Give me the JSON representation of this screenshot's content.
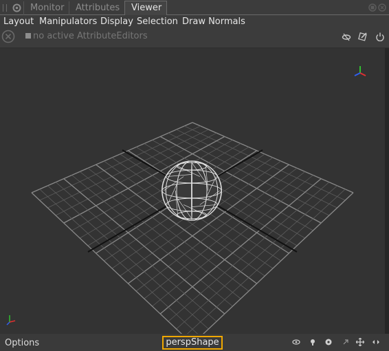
{
  "tabs": [
    {
      "label": "Monitor",
      "active": false
    },
    {
      "label": "Attributes",
      "active": false
    },
    {
      "label": "Viewer",
      "active": true
    }
  ],
  "menu": [
    "Layout",
    "Manipulators",
    "Display",
    "Selection",
    "Draw Normals"
  ],
  "info": {
    "text": "no active AttributeEditors"
  },
  "viewport": {
    "background": "#333333",
    "axis_colors": {
      "x": "#e03030",
      "y": "#30c030",
      "z": "#3060f0"
    }
  },
  "bottom": {
    "options_label": "Options",
    "camera_label": "perspShape",
    "camera_outline_color": "#f0a800"
  },
  "icons": {
    "tab_left": [
      "drag-handle-icon",
      "gear-icon"
    ],
    "tab_right": [
      "restore-icon",
      "close-icon"
    ],
    "info_left": [
      "close-circle-icon"
    ],
    "info_right": [
      "visibility-toggle-icon",
      "edit-icon",
      "power-icon"
    ],
    "bottom_right": [
      "eye-icon",
      "bulb-icon",
      "settings-icon",
      "arrow-icon",
      "move-icon",
      "expand-icon"
    ]
  }
}
